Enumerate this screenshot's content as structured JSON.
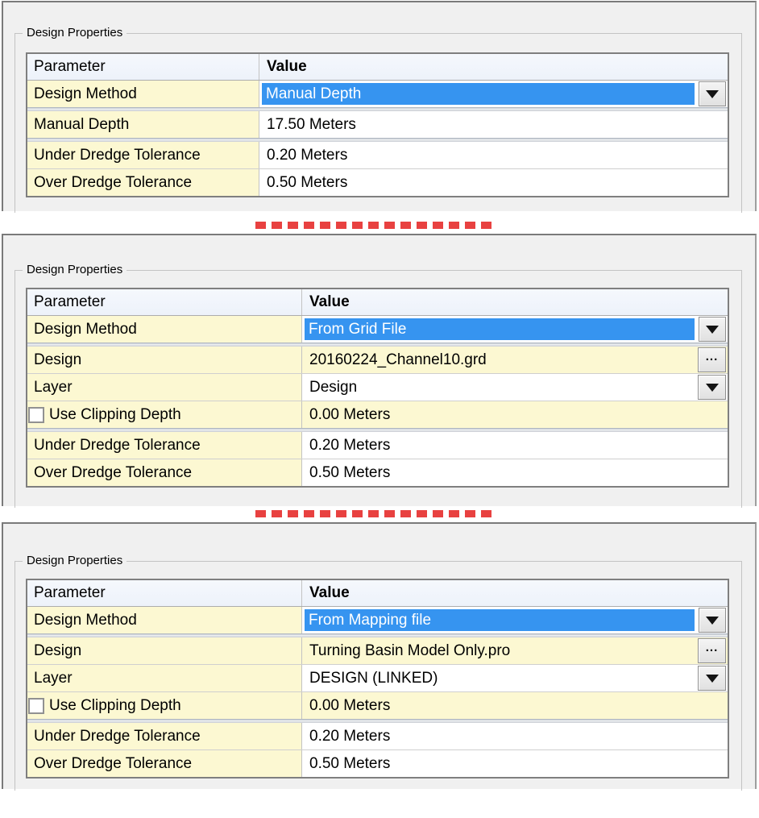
{
  "colors": {
    "accent_blue": "#3694f0",
    "row_yellow": "#fcf8d2",
    "separator_red": "#e84140",
    "window_gray": "#f0f0f0"
  },
  "controls": {
    "browse_button_label": "...",
    "dropdown_icon": "down-triangle"
  },
  "panels": [
    {
      "title": "Design Properties",
      "header": {
        "parameter": "Parameter",
        "value": "Value"
      },
      "rows": [
        {
          "param": "Design Method",
          "value": "Manual Depth",
          "control": "dropdown-selected"
        },
        {
          "param": "Manual Depth",
          "value": "17.50 Meters",
          "control": "none"
        },
        {
          "param": "Under Dredge Tolerance",
          "value": "0.20 Meters",
          "control": "none"
        },
        {
          "param": "Over Dredge Tolerance",
          "value": "0.50 Meters",
          "control": "none"
        }
      ]
    },
    {
      "title": "Design Properties",
      "header": {
        "parameter": "Parameter",
        "value": "Value"
      },
      "rows": [
        {
          "param": "Design Method",
          "value": "From Grid File",
          "control": "dropdown-selected"
        },
        {
          "param": "Design",
          "value": "20160224_Channel10.grd",
          "control": "browse"
        },
        {
          "param": "Layer",
          "value": "Design",
          "control": "dropdown"
        },
        {
          "param": "Use Clipping Depth",
          "value": "0.00 Meters",
          "control": "checkbox",
          "checked": false
        },
        {
          "param": "Under Dredge Tolerance",
          "value": "0.20 Meters",
          "control": "none"
        },
        {
          "param": "Over Dredge Tolerance",
          "value": "0.50 Meters",
          "control": "none"
        }
      ]
    },
    {
      "title": "Design Properties",
      "header": {
        "parameter": "Parameter",
        "value": "Value"
      },
      "rows": [
        {
          "param": "Design Method",
          "value": "From Mapping file",
          "control": "dropdown-selected"
        },
        {
          "param": "Design",
          "value": "Turning Basin Model Only.pro",
          "control": "browse"
        },
        {
          "param": "Layer",
          "value": "DESIGN (LINKED)",
          "control": "dropdown"
        },
        {
          "param": "Use Clipping Depth",
          "value": "0.00 Meters",
          "control": "checkbox",
          "checked": false
        },
        {
          "param": "Under Dredge Tolerance",
          "value": "0.20 Meters",
          "control": "none"
        },
        {
          "param": "Over Dredge Tolerance",
          "value": "0.50 Meters",
          "control": "none"
        }
      ]
    }
  ]
}
